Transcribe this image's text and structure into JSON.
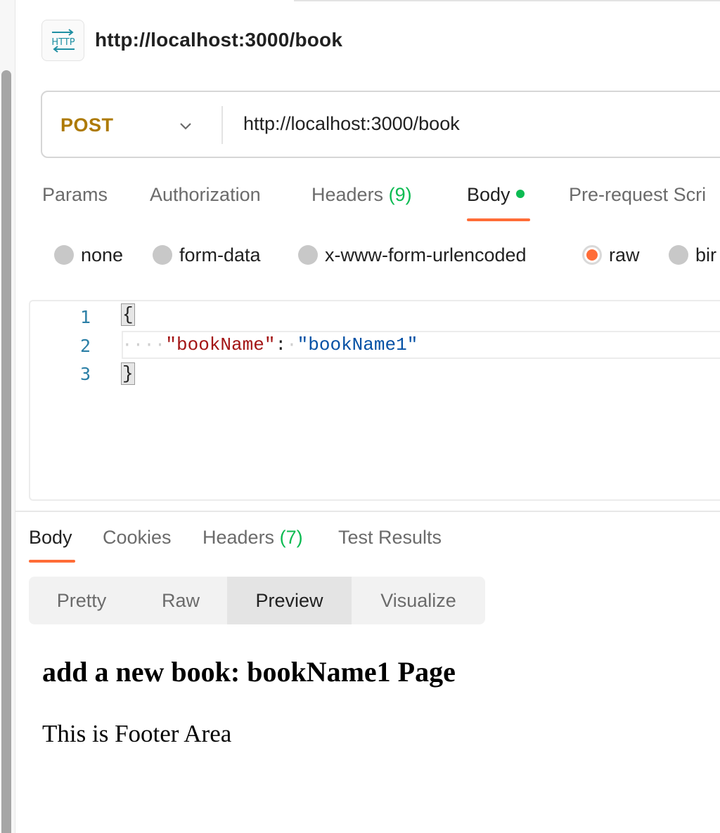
{
  "request": {
    "icon": "http-icon",
    "icon_text": "HTTP",
    "title": "http://localhost:3000/book",
    "method": "POST",
    "url": "http://localhost:3000/book"
  },
  "request_tabs": {
    "params": "Params",
    "authorization": "Authorization",
    "headers": "Headers",
    "headers_count": "(9)",
    "body": "Body",
    "pre_request": "Pre-request Scri"
  },
  "body_types": {
    "none": "none",
    "form_data": "form-data",
    "urlencoded": "x-www-form-urlencoded",
    "raw": "raw",
    "binary": "bir",
    "selected": "raw"
  },
  "editor": {
    "line_numbers": [
      "1",
      "2",
      "3"
    ],
    "open_brace": "{",
    "key": "\"bookName\"",
    "colon": ":",
    "value": "\"bookName1\"",
    "close_brace": "}"
  },
  "response_tabs": {
    "body": "Body",
    "cookies": "Cookies",
    "headers": "Headers",
    "headers_count": "(7)",
    "test_results": "Test Results"
  },
  "view_modes": {
    "pretty": "Pretty",
    "raw": "Raw",
    "preview": "Preview",
    "visualize": "Visualize",
    "selected": "Preview"
  },
  "preview": {
    "heading": "add a new book: bookName1 Page",
    "footer": "This is Footer Area"
  },
  "colors": {
    "accent": "#ff6c37",
    "method": "#ad7a03",
    "count": "#0cbb52",
    "icon": "#1f8fa3"
  }
}
